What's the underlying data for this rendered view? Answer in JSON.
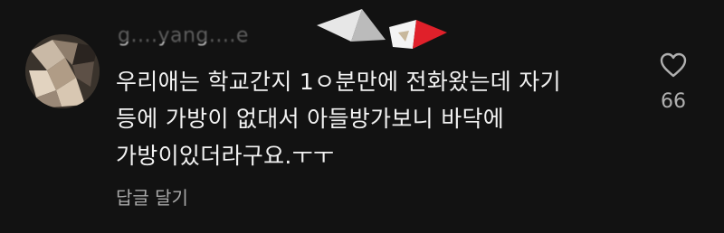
{
  "comment": {
    "username": "g....yang....e",
    "text_lines": [
      "우리애는 학교간지 1ㅇ분만에 전화왔는데 자기",
      "등에 가방이 없대서 아들방가보니 바닥에",
      "가방이있더라구요.ㅜㅜ"
    ],
    "reply_label": "답글 달기",
    "like_count": "66",
    "like_icon": "heart-outline-icon"
  },
  "colors": {
    "background": "#121212",
    "text": "#f2f2f2",
    "secondary_text": "#a8a8a8",
    "scribble_red": "#e0202a"
  }
}
